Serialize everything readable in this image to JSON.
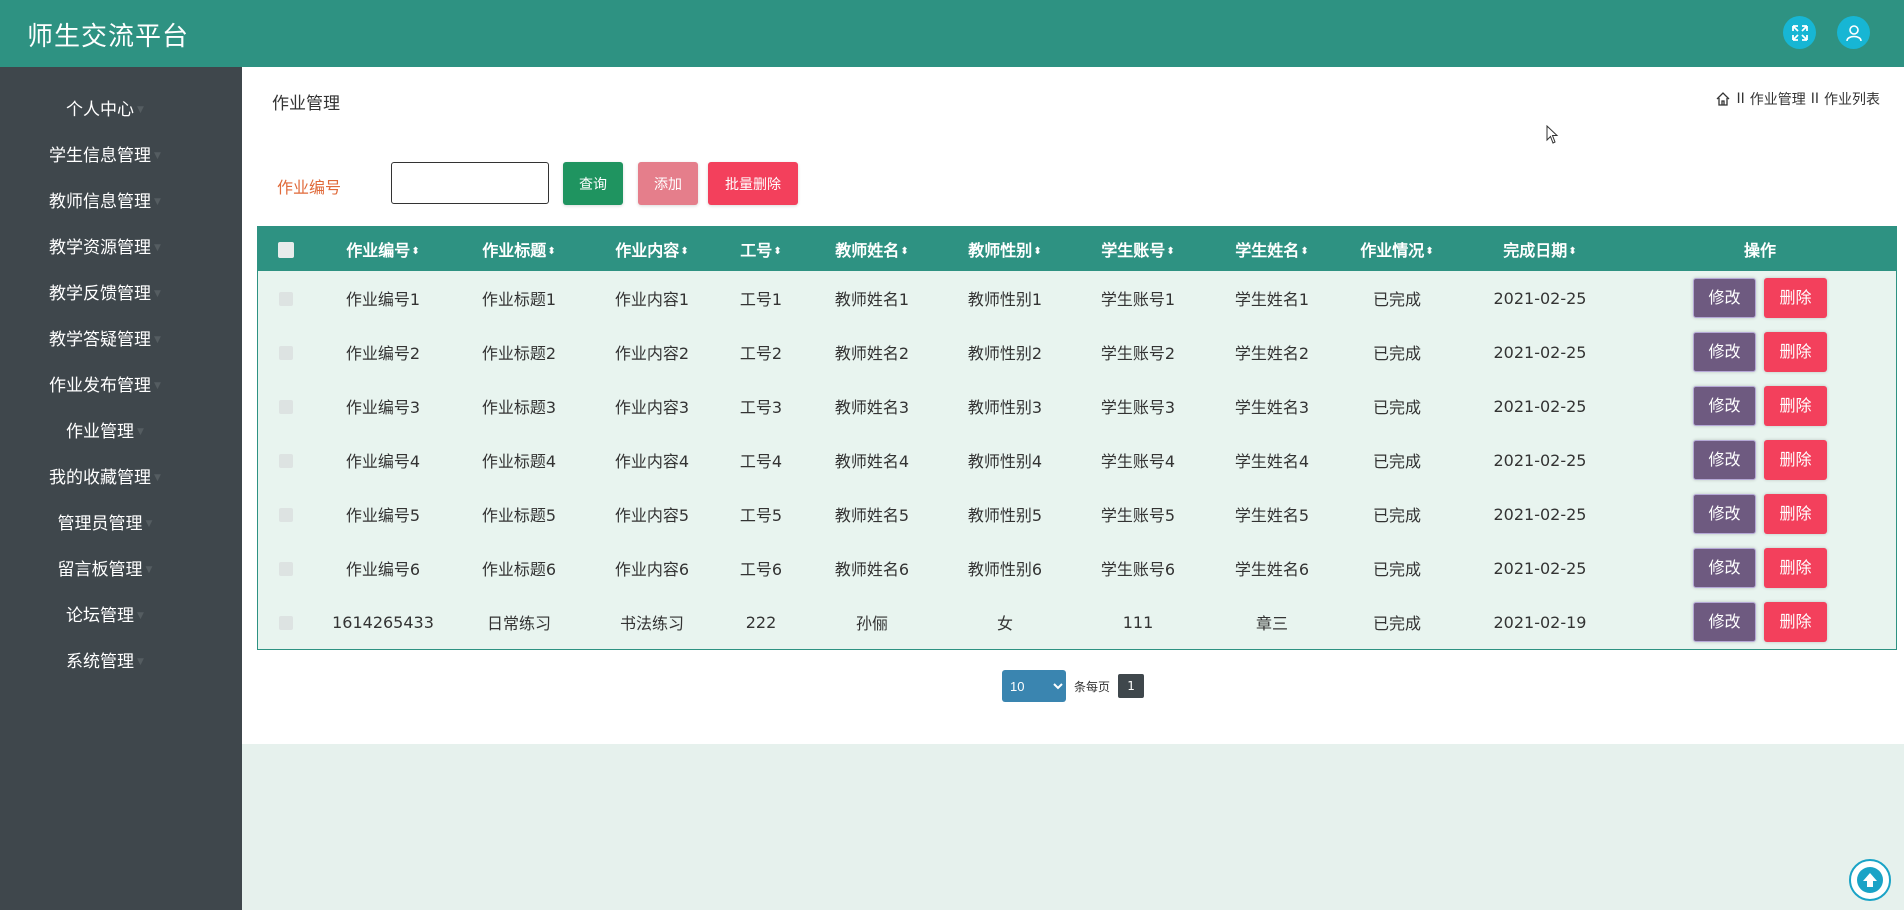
{
  "app": {
    "title": "师生交流平台"
  },
  "header_icons": [
    "expand-icon",
    "user-icon"
  ],
  "sidebar": {
    "items": [
      {
        "label": "个人中心"
      },
      {
        "label": "学生信息管理"
      },
      {
        "label": "教师信息管理"
      },
      {
        "label": "教学资源管理"
      },
      {
        "label": "教学反馈管理"
      },
      {
        "label": "教学答疑管理"
      },
      {
        "label": "作业发布管理"
      },
      {
        "label": "作业管理"
      },
      {
        "label": "我的收藏管理"
      },
      {
        "label": "管理员管理"
      },
      {
        "label": "留言板管理"
      },
      {
        "label": "论坛管理"
      },
      {
        "label": "系统管理"
      }
    ]
  },
  "page": {
    "heading": "作业管理",
    "breadcrumb": {
      "separator": "II",
      "parent": "作业管理",
      "current": "作业列表"
    }
  },
  "search": {
    "label": "作业编号",
    "value": "",
    "placeholder": ""
  },
  "buttons": {
    "query": "查询",
    "add": "添加",
    "bulk_delete": "批量删除"
  },
  "table": {
    "headers": [
      "作业编号",
      "作业标题",
      "作业内容",
      "工号",
      "教师姓名",
      "教师性别",
      "学生账号",
      "学生姓名",
      "作业情况",
      "完成日期"
    ],
    "action_header": "操作",
    "edit_label": "修改",
    "delete_label": "删除",
    "rows": [
      [
        "作业编号1",
        "作业标题1",
        "作业内容1",
        "工号1",
        "教师姓名1",
        "教师性别1",
        "学生账号1",
        "学生姓名1",
        "已完成",
        "2021-02-25"
      ],
      [
        "作业编号2",
        "作业标题2",
        "作业内容2",
        "工号2",
        "教师姓名2",
        "教师性别2",
        "学生账号2",
        "学生姓名2",
        "已完成",
        "2021-02-25"
      ],
      [
        "作业编号3",
        "作业标题3",
        "作业内容3",
        "工号3",
        "教师姓名3",
        "教师性别3",
        "学生账号3",
        "学生姓名3",
        "已完成",
        "2021-02-25"
      ],
      [
        "作业编号4",
        "作业标题4",
        "作业内容4",
        "工号4",
        "教师姓名4",
        "教师性别4",
        "学生账号4",
        "学生姓名4",
        "已完成",
        "2021-02-25"
      ],
      [
        "作业编号5",
        "作业标题5",
        "作业内容5",
        "工号5",
        "教师姓名5",
        "教师性别5",
        "学生账号5",
        "学生姓名5",
        "已完成",
        "2021-02-25"
      ],
      [
        "作业编号6",
        "作业标题6",
        "作业内容6",
        "工号6",
        "教师姓名6",
        "教师性别6",
        "学生账号6",
        "学生姓名6",
        "已完成",
        "2021-02-25"
      ],
      [
        "1614265433",
        "日常练习",
        "书法练习",
        "222",
        "孙俪",
        "女",
        "111",
        "章三",
        "已完成",
        "2021-02-19"
      ]
    ]
  },
  "pagination": {
    "page_size": "10",
    "per_page_label": "条每页",
    "current_page": "1"
  },
  "colors": {
    "header": "#2e9282",
    "sidebar": "#3f474c",
    "query": "#1f9460",
    "add": "#e57e8b",
    "delete": "#f3405c",
    "edit": "#6e5a80"
  }
}
